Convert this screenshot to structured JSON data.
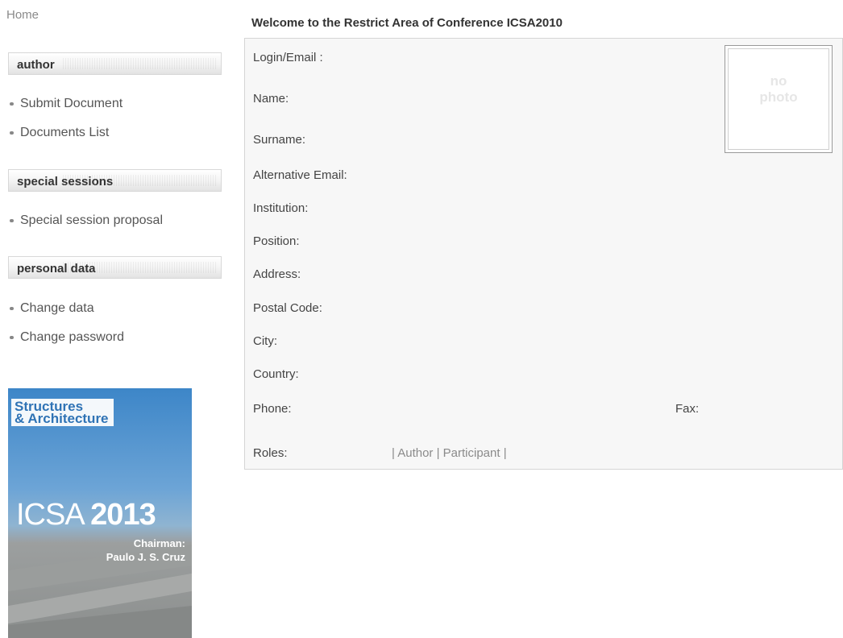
{
  "nav": {
    "home_label": "Home"
  },
  "sidebar": {
    "sections": [
      {
        "title": "author",
        "items": [
          "Submit Document",
          "Documents List"
        ]
      },
      {
        "title": "special sessions",
        "items": [
          "Special session proposal"
        ]
      },
      {
        "title": "personal data",
        "items": [
          "Change data",
          "Change password"
        ]
      }
    ],
    "poster": {
      "title_line1": "Structures",
      "title_line2": "& Architecture",
      "event": "ICSA",
      "year": "2013",
      "chair_label": "Chairman:",
      "chair_name": "Paulo J. S. Cruz",
      "accent_color": "#3d86c8"
    }
  },
  "main": {
    "welcome_title": "Welcome to the Restrict Area of Conference ICSA2010",
    "fields": {
      "login": "Login/Email :",
      "name": "Name:",
      "surname": "Surname:",
      "alt_email": "Alternative Email:",
      "institution": "Institution:",
      "position": "Position:",
      "address": "Address:",
      "postal_code": "Postal Code:",
      "city": "City:",
      "country": "Country:",
      "phone": "Phone:",
      "fax": "Fax:",
      "roles": "Roles:"
    },
    "roles_value": "| Author | Participant |",
    "photo": {
      "line1": "no",
      "line2": "photo"
    }
  }
}
